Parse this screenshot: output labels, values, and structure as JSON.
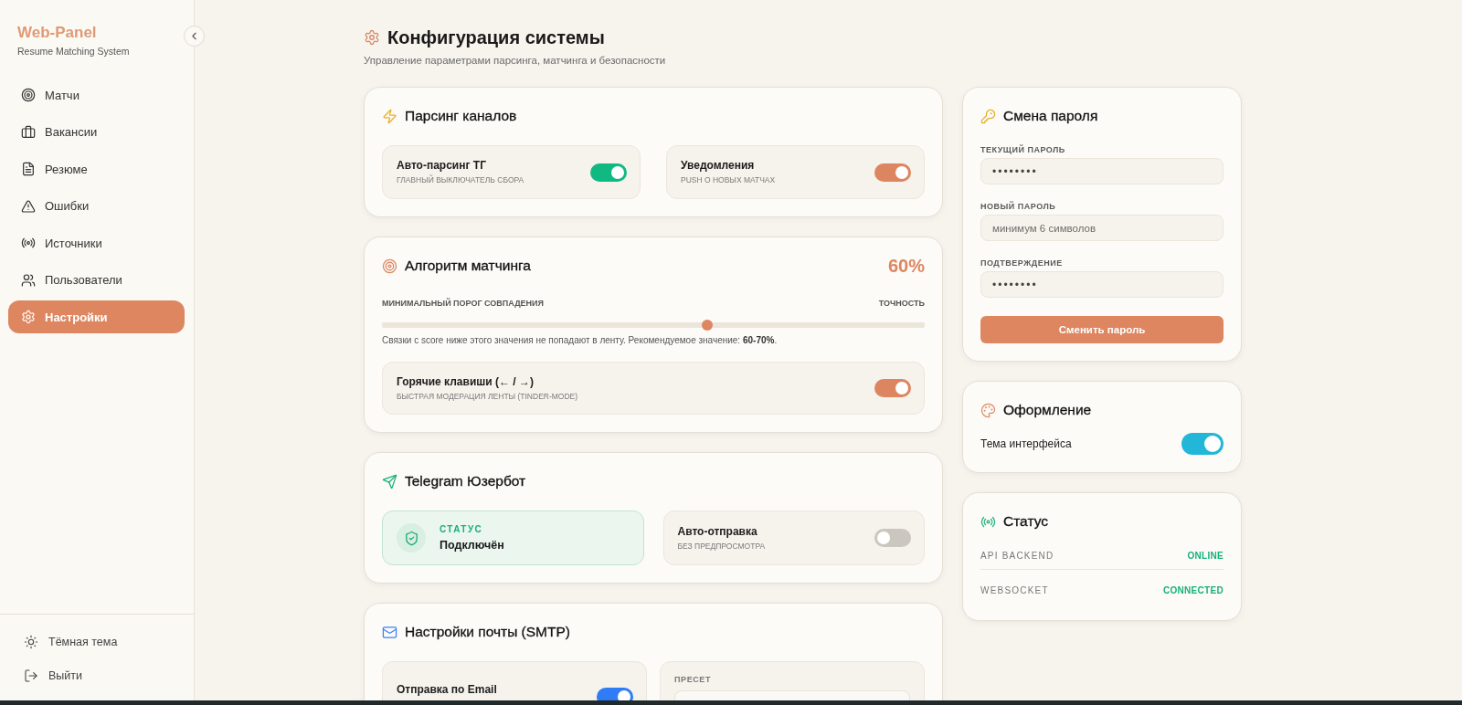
{
  "sidebar": {
    "logo": "Web-Panel",
    "subtitle": "Resume Matching System",
    "items": [
      {
        "label": "Матчи",
        "selected": false
      },
      {
        "label": "Вакансии",
        "selected": false
      },
      {
        "label": "Резюме",
        "selected": false
      },
      {
        "label": "Ошибки",
        "selected": false
      },
      {
        "label": "Источники",
        "selected": false
      },
      {
        "label": "Пользователи",
        "selected": false
      },
      {
        "label": "Настройки",
        "selected": true
      }
    ],
    "footer": [
      {
        "label": "Тёмная тема"
      },
      {
        "label": "Выйти"
      }
    ]
  },
  "header": {
    "title": "Конфигурация системы",
    "subtitle": "Управление параметрами парсинга, матчинга и безопасности"
  },
  "main_column": [
    {
      "kind": "toggles",
      "title": "Парсинг каналов",
      "tiles": [
        {
          "label": "Авто-парсинг ТГ",
          "hint": "ГЛАВНЫЙ ВЫКЛЮЧАТЕЛЬ СБОРА",
          "on": true,
          "color": "#10b981"
        },
        {
          "label": "Уведомления",
          "hint": "PUSH О НОВЫХ МАТЧАХ",
          "on": true,
          "color": "#dd8460"
        }
      ]
    },
    {
      "kind": "matching",
      "title": "Алгоритм матчинга",
      "value": "60%",
      "slider": {
        "label": "МИНИМАЛЬНЫЙ ПОРОГ СОВПАДЕНИЯ",
        "end_label": "ТОЧНОСТЬ",
        "level": 0.6
      },
      "note": "Связки с score ниже этого значения не попадают в ленту. Рекомендуемое значение: **60-70%**.",
      "tiles": [
        {
          "label": "Горячие клавиши (← / →)",
          "hint": "БЫСТРАЯ МОДЕРАЦИЯ ЛЕНТЫ (TINDER-MODE)",
          "on": true,
          "color": "#dd8460"
        }
      ]
    },
    {
      "kind": "telegram",
      "title": "Telegram Юзербот",
      "status": {
        "label": "СТАТУС",
        "value": "Подключён"
      },
      "tiles": [
        {
          "label": "Авто-отправка",
          "hint": "БЕЗ ПРЕДПРОСМОТРА",
          "on": false
        }
      ]
    },
    {
      "kind": "smtp",
      "title": "Настройки почты (SMTP)",
      "tiles": [
        {
          "label": "Отправка по Email",
          "on": true,
          "color": "#2f7cf6"
        }
      ],
      "preset": {
        "label": "ПРЕСЕТ"
      }
    }
  ],
  "side_column": [
    {
      "kind": "password",
      "title": "Смена пароля",
      "fields": [
        {
          "label": "ТЕКУЩИЙ ПАРОЛЬ",
          "value": "••••••••"
        },
        {
          "label": "НОВЫЙ ПАРОЛЬ",
          "placeholder": "минимум 6 символов"
        },
        {
          "label": "ПОДТВЕРЖДЕНИЕ",
          "value": "••••••••"
        }
      ],
      "button": "Сменить пароль"
    },
    {
      "kind": "appearance",
      "title": "Оформление",
      "toggle": {
        "label": "Тема интерфейса",
        "on": true,
        "color": "#22b6d9"
      }
    },
    {
      "kind": "status",
      "title": "Статус",
      "rows": [
        {
          "name": "API BACKEND",
          "value": "ONLINE"
        },
        {
          "name": "WEBSOCKET",
          "value": "CONNECTED"
        }
      ]
    }
  ]
}
